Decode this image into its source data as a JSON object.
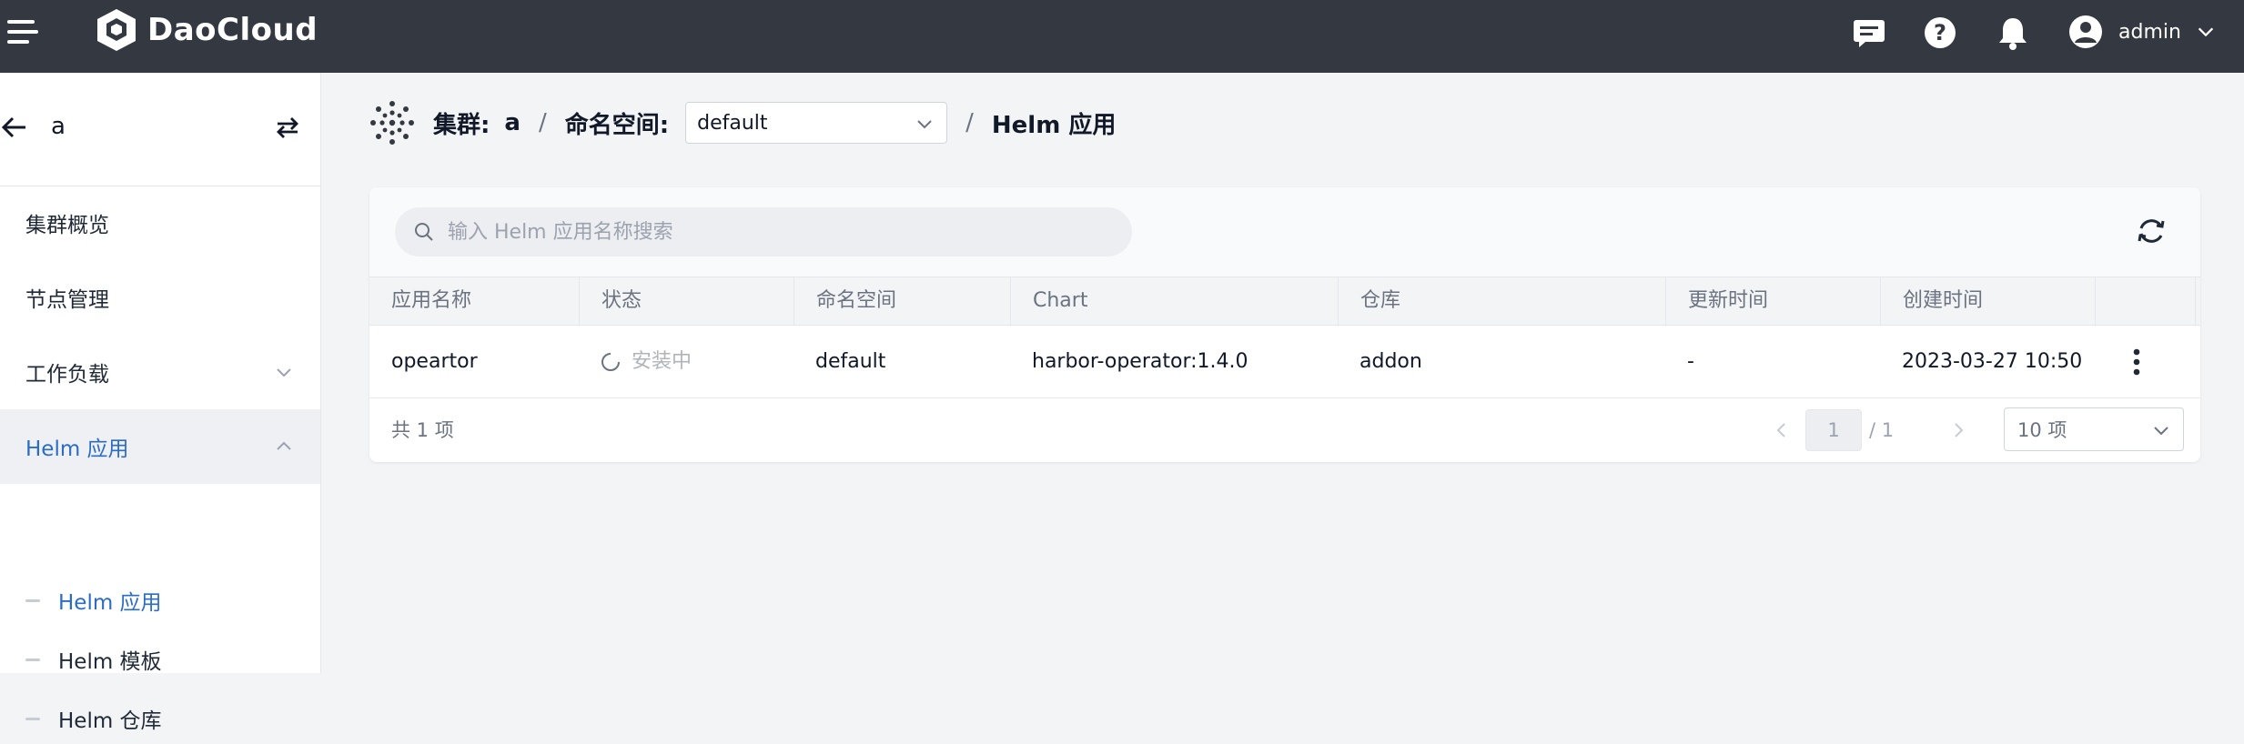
{
  "topbar": {
    "brand": "DaoCloud",
    "user": "admin",
    "icons": [
      "menu-icon",
      "logo-icon",
      "message-icon",
      "help-icon",
      "bell-icon",
      "user-avatar-icon",
      "chevron-down-icon"
    ]
  },
  "sidebar": {
    "cluster": "a",
    "items": [
      {
        "label": "集群概览"
      },
      {
        "label": "节点管理"
      },
      {
        "label": "工作负载"
      },
      {
        "label": "Helm 应用"
      }
    ],
    "subitems": [
      {
        "label": "Helm 应用"
      },
      {
        "label": "Helm 模板"
      },
      {
        "label": "Helm 仓库"
      }
    ]
  },
  "breadcrumb": {
    "cluster_label": "集群:",
    "cluster_value": "a",
    "sep1": "/",
    "namespace_label": "命名空间:",
    "namespace_value": "default",
    "sep2": "/",
    "page": "Helm 应用"
  },
  "search": {
    "placeholder": "输入 Helm 应用名称搜索"
  },
  "table": {
    "headers": [
      "应用名称",
      "状态",
      "命名空间",
      "Chart",
      "仓库",
      "更新时间",
      "创建时间"
    ],
    "rows": [
      {
        "name": "opeartor",
        "status": "安装中",
        "namespace": "default",
        "chart": "harbor-operator:1.4.0",
        "repo": "addon",
        "updated": "-",
        "created": "2023-03-27 10:50"
      }
    ]
  },
  "pagination": {
    "total": "共 1 项",
    "current": "1",
    "pages": "/ 1",
    "page_size": "10 项"
  },
  "colors": {
    "topbar": "#343840",
    "accent": "#2b6cc4",
    "background": "#f3f4f6"
  }
}
